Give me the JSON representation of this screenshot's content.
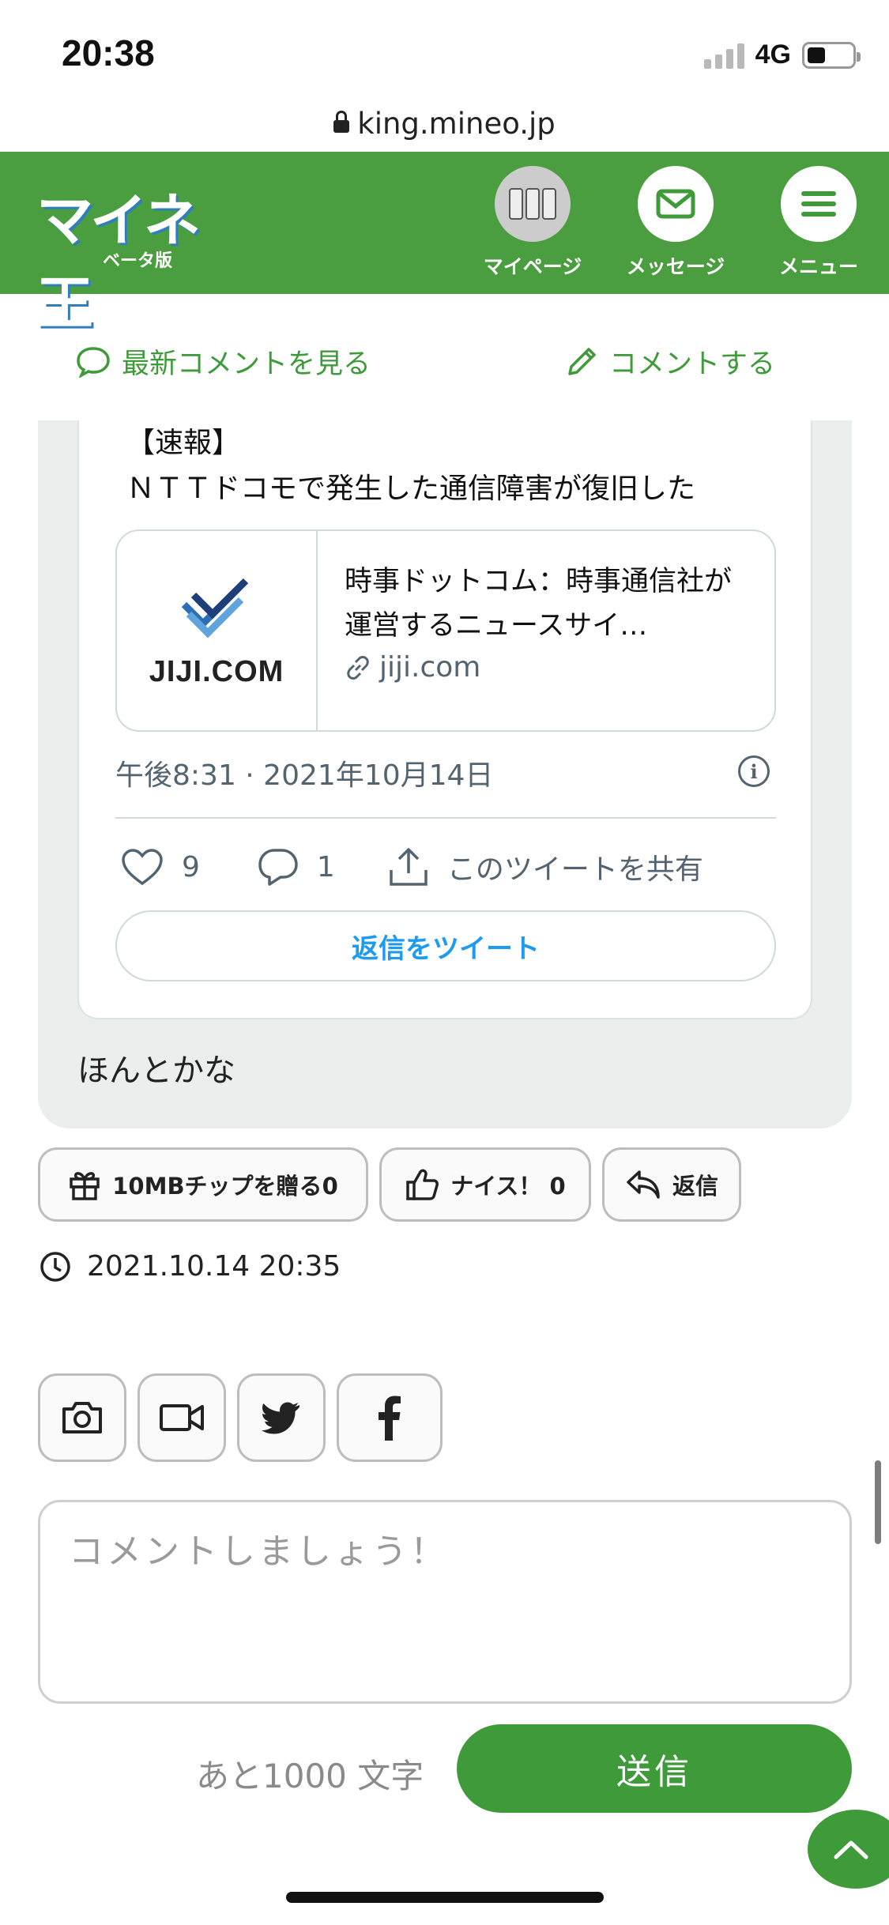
{
  "status_bar": {
    "time": "20:38",
    "network": "4G"
  },
  "browser": {
    "url": "king.mineo.jp"
  },
  "header": {
    "logo_text": "マイネ王",
    "logo_sub": "ベータ版",
    "nav": [
      {
        "label": "マイページ",
        "icon": "avatar"
      },
      {
        "label": "メッセージ",
        "icon": "envelope-icon"
      },
      {
        "label": "メニュー",
        "icon": "menu-icon"
      }
    ],
    "brand_color": "#4a9e3f"
  },
  "comment_links": {
    "latest": "最新コメントを見る",
    "post": "コメントする"
  },
  "tweet": {
    "text_line1": "【速報】",
    "text_line2": "ＮＴＴドコモで発生した通信障害が復旧した",
    "link_card": {
      "thumb_text": "JIJI.COM",
      "title": "時事ドットコム：時事通信社が運営するニュースサイ…",
      "domain": "jiji.com"
    },
    "date": "午後8:31 · 2021年10月14日",
    "likes": "9",
    "replies": "1",
    "share_label": "このツイートを共有",
    "reply_button": "返信をツイート"
  },
  "comment": {
    "text": "ほんとかな",
    "timestamp": "2021.10.14 20:35"
  },
  "actions": {
    "gift": "10MBチップを贈る",
    "gift_count": "0",
    "nice": "ナイス！",
    "nice_count": "0",
    "reply": "返信"
  },
  "form": {
    "placeholder": "コメントしましょう！",
    "remaining": "あと1000 文字",
    "send": "送信"
  }
}
